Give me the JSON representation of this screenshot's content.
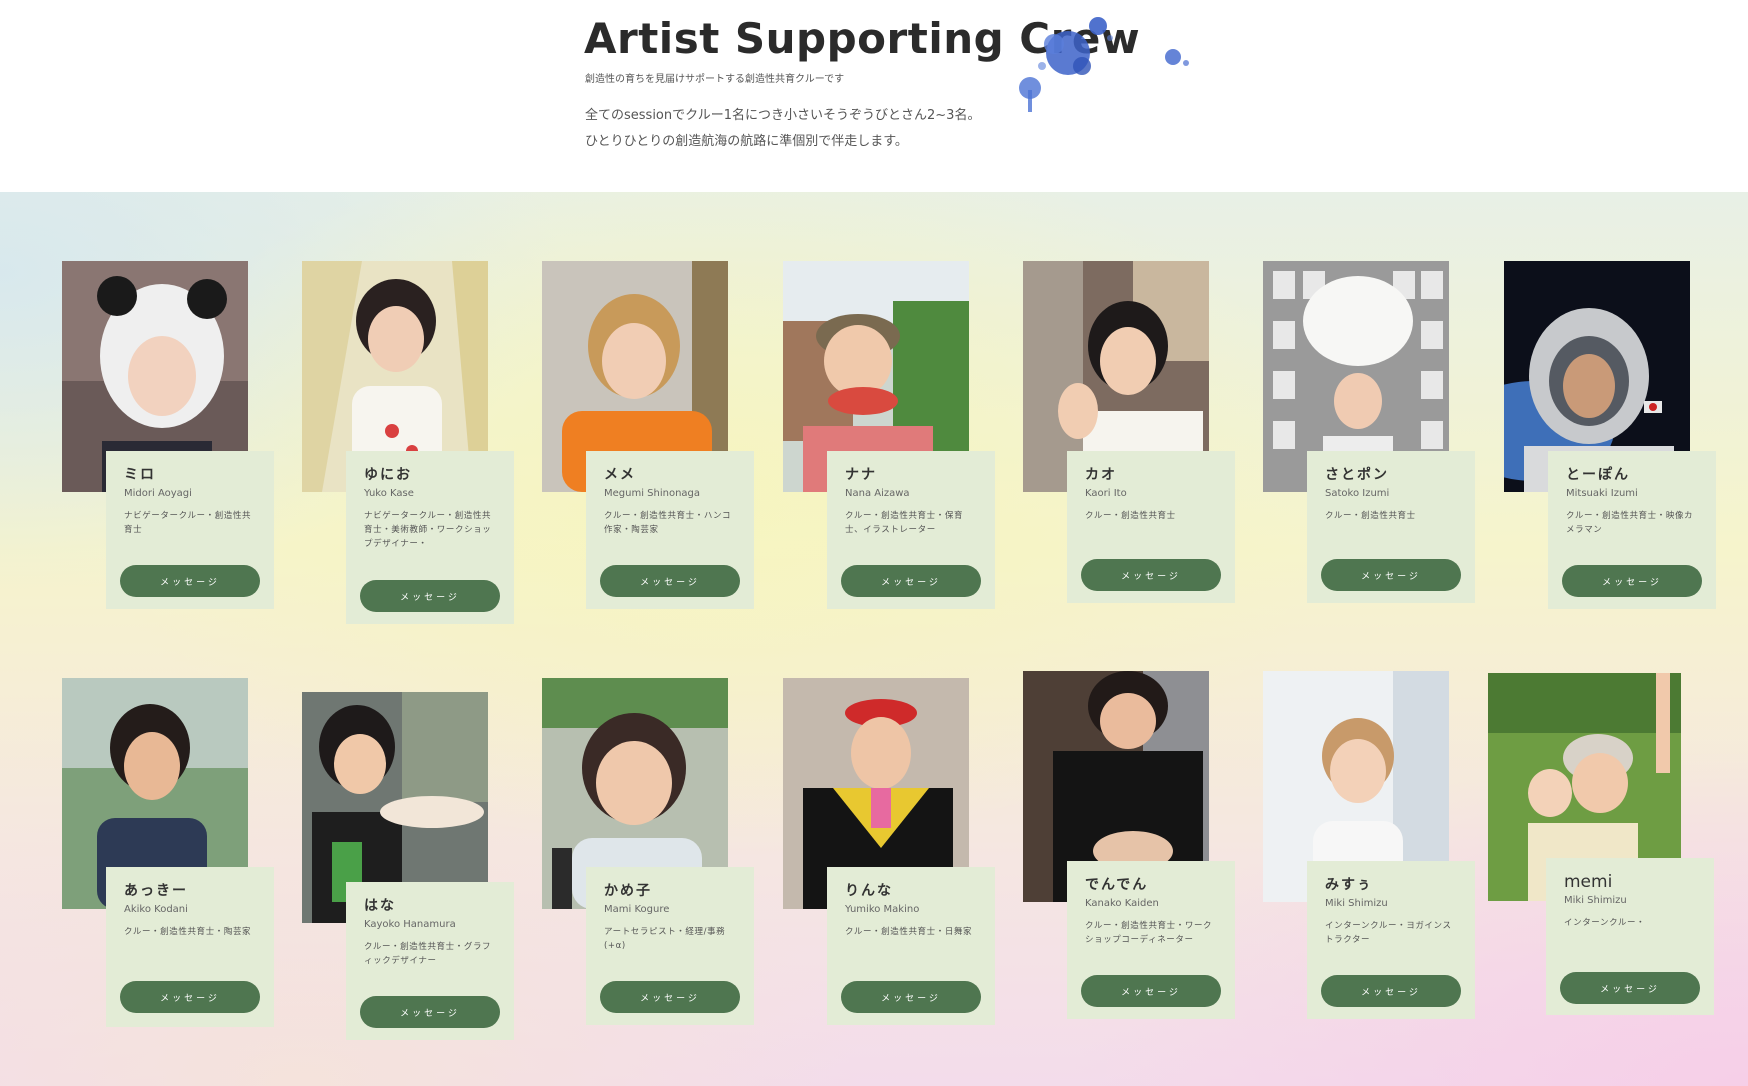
{
  "header": {
    "title": "Artist Supporting Crew",
    "subtitle": "創造性の育ちを見届けサポートする創造性共育クルーです",
    "intro_line1": "全てのsessionでクルー1名につき小さいそうぞうびとさん2~3名。",
    "intro_line2": "ひとりひとりの創造航海の航路に準個別で伴走します。"
  },
  "accent_color": "#4f7650",
  "card_color": "#e3ecd6",
  "crew": [
    {
      "nick": "ミロ",
      "romaji": "Midori Aoyagi",
      "role": "ナビゲータークルー・創造性共育士",
      "button": "メッセージ"
    },
    {
      "nick": "ゆにお",
      "romaji": "Yuko Kase",
      "role": "ナビゲータークルー・創造性共育士・美術教師・ワークショップデザイナー・",
      "button": "メッセージ"
    },
    {
      "nick": "メメ",
      "romaji": "Megumi Shinonaga",
      "role": "クルー・創造性共育士・ハンコ作家・陶芸家",
      "button": "メッセージ"
    },
    {
      "nick": "ナナ",
      "romaji": "Nana Aizawa",
      "role": "クルー・創造性共育士・保育士、イラストレーター",
      "button": "メッセージ"
    },
    {
      "nick": "カオ",
      "romaji": "Kaori Ito",
      "role": "クルー・創造性共育士",
      "button": "メッセージ"
    },
    {
      "nick": "さとポン",
      "romaji": "Satoko Izumi",
      "role": "クルー・創造性共育士",
      "button": "メッセージ"
    },
    {
      "nick": "とーぽん",
      "romaji": "Mitsuaki Izumi",
      "role": "クルー・創造性共育士・映像カメラマン",
      "button": "メッセージ"
    },
    {
      "nick": "あっきー",
      "romaji": "Akiko Kodani",
      "role": "クルー・創造性共育士・陶芸家",
      "button": "メッセージ"
    },
    {
      "nick": "はな",
      "romaji": "Kayoko Hanamura",
      "role": "クルー・創造性共育士・グラフィックデザイナー",
      "button": "メッセージ"
    },
    {
      "nick": "かめ子",
      "romaji": "Mami Kogure",
      "role": "アートセラピスト・経理/事務(+α)",
      "button": "メッセージ"
    },
    {
      "nick": "りんな",
      "romaji": "Yumiko Makino",
      "role": "クルー・創造性共育士・日舞家",
      "button": "メッセージ"
    },
    {
      "nick": "でんでん",
      "romaji": "Kanako Kaiden",
      "role": "クルー・創造性共育士・ワークショップコーディネーター",
      "button": "メッセージ"
    },
    {
      "nick": "みすぅ",
      "romaji": "Miki Shimizu",
      "role": "インターンクルー・ヨガインストラクター",
      "button": "メッセージ"
    },
    {
      "nick": "memi",
      "romaji": "Miki Shimizu",
      "role": "インターンクルー・",
      "button": "メッセージ"
    }
  ]
}
